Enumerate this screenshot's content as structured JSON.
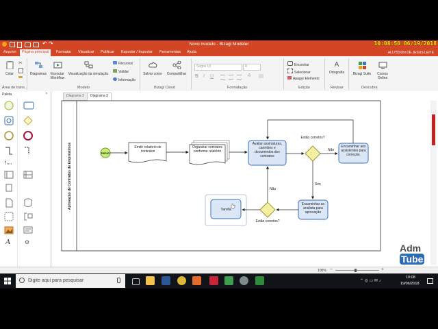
{
  "window": {
    "title": "Novo modelo - Bizagi Modeler",
    "clock": "10:08:50  06/19/2018"
  },
  "menu": {
    "items": [
      "Arquivo",
      "Página principal",
      "Formatar",
      "Visualizar",
      "Publicar",
      "Exportar / Importar",
      "Ferramentas",
      "Ajuda"
    ],
    "user": "ALLYSSON DE JESUS LEITE"
  },
  "ribbon": {
    "colar": "Colar",
    "area_transf": "Área de trans...",
    "diagramas": "Diagramas",
    "executar": "Executar Workflow",
    "visualizacao": "Visualização da simulação",
    "recursos": "Recursos",
    "validar": "Validar",
    "informacao": "Informação",
    "modelo_label": "Modelo",
    "salvar_como": "Salvar como",
    "compartilhar": "Compartilhar",
    "bizagi_cloud": "Bizagi Cloud",
    "font_name": "Segoe UI",
    "font_size": "8",
    "formatacao": "Formatação",
    "encontrar": "Encontrar",
    "selecionar": "Selecionar",
    "apagar": "Apagar Elemento",
    "edicao": "Edição",
    "ortografia": "Ortografia",
    "revisar": "Revisar",
    "bizagi_suite": "Bizagi Suite",
    "cursos": "Cursos Online",
    "descubra": "Descubra"
  },
  "palette": {
    "title": "Paleta"
  },
  "tabs": [
    "Diagrama 2",
    "Diagrama 3"
  ],
  "diagram": {
    "lane": "Aprovação de Contratos de Empréstimos",
    "start": "Início",
    "emitir": "Emitir relatório de contratos",
    "organizar": "Organizar contratos conforme relatório",
    "avaliar": "Avaliar assinaturas, carimbos e documentos dos contratos",
    "gw1_label": "Estão corretos?",
    "nao1": "Não",
    "encaminhar_assist": "Encaminhar aos assistentes para correção.",
    "sim": "Sim",
    "encaminhar_analista": "Encaminhar ao analista para aprovação",
    "gw2_label": "Estão corretos?",
    "nao2": "Não",
    "tarefa": "Tarefa"
  },
  "status": {
    "zoom": "100%"
  },
  "taskbar": {
    "search_placeholder": "Digite aqui para pesquisar",
    "time": "10:08",
    "date": "19/06/2018"
  },
  "logo": {
    "line1": "Adm",
    "line2": "Tube"
  },
  "colors": {
    "accent": "#d24625",
    "task_fill": "#dbe7f7",
    "task_stroke": "#3a6fb0",
    "gateway": "#f3f0a0",
    "start": "#c6ec7a"
  }
}
